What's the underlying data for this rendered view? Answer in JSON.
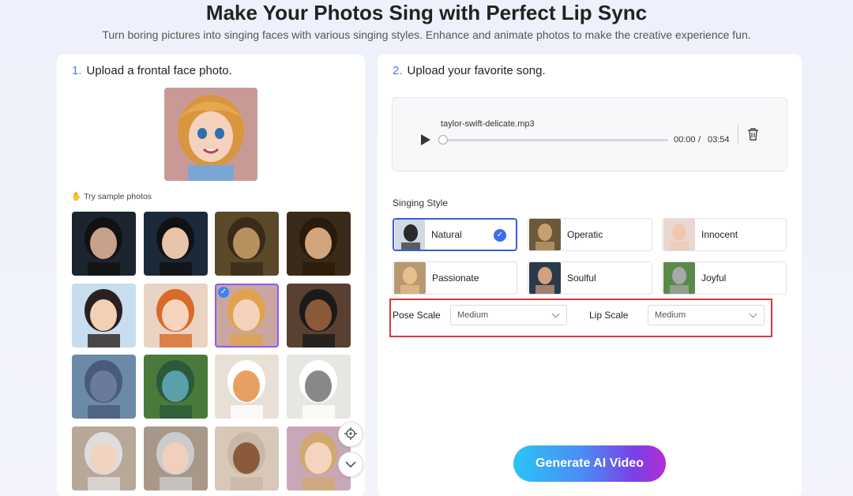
{
  "header": {
    "title": "Make Your Photos Sing with Perfect Lip Sync",
    "subtitle": "Turn boring pictures into singing faces with various singing styles. Enhance and animate photos to make the creative experience fun."
  },
  "upload_photo": {
    "step_number": "1.",
    "step_label": "Upload a frontal face photo.",
    "sample_label": "Try sample photos",
    "samples": [
      {
        "subject": "man-in-black-suit"
      },
      {
        "subject": "woman-in-black-jacket"
      },
      {
        "subject": "mona-lisa"
      },
      {
        "subject": "classical-portrait-man"
      },
      {
        "subject": "cartoon-boy"
      },
      {
        "subject": "cartoon-redhead-girl"
      },
      {
        "subject": "cartoon-blonde-girl",
        "selected": true
      },
      {
        "subject": "cartoon-man-suit"
      },
      {
        "subject": "cartoon-cat"
      },
      {
        "subject": "cartoon-monster"
      },
      {
        "subject": "corgi-dog"
      },
      {
        "subject": "tabby-cat"
      },
      {
        "subject": "cartoon-old-man"
      },
      {
        "subject": "cartoon-old-woman"
      },
      {
        "subject": "cartoon-kid-bear-hat"
      },
      {
        "subject": "cartoon-girl"
      }
    ]
  },
  "upload_song": {
    "step_number": "2.",
    "step_label": "Upload your favorite song.",
    "file_name": "taylor-swift-delicate.mp3",
    "current_time": "00:00",
    "separator": "/",
    "duration": "03:54",
    "progress": 0
  },
  "singing_style": {
    "label": "Singing Style",
    "styles": [
      {
        "label": "Natural",
        "selected": true
      },
      {
        "label": "Operatic"
      },
      {
        "label": "Innocent"
      },
      {
        "label": "Passionate"
      },
      {
        "label": "Soulful"
      },
      {
        "label": "Joyful"
      }
    ]
  },
  "options": {
    "pose_label": "Pose Scale",
    "pose_value": "Medium",
    "lip_label": "Lip Scale",
    "lip_value": "Medium"
  },
  "generate_label": "Generate AI Video",
  "colors": {
    "accent": "#3b6df0",
    "highlight": "#d93a3a",
    "selected_outline": "#8b5cf6"
  }
}
